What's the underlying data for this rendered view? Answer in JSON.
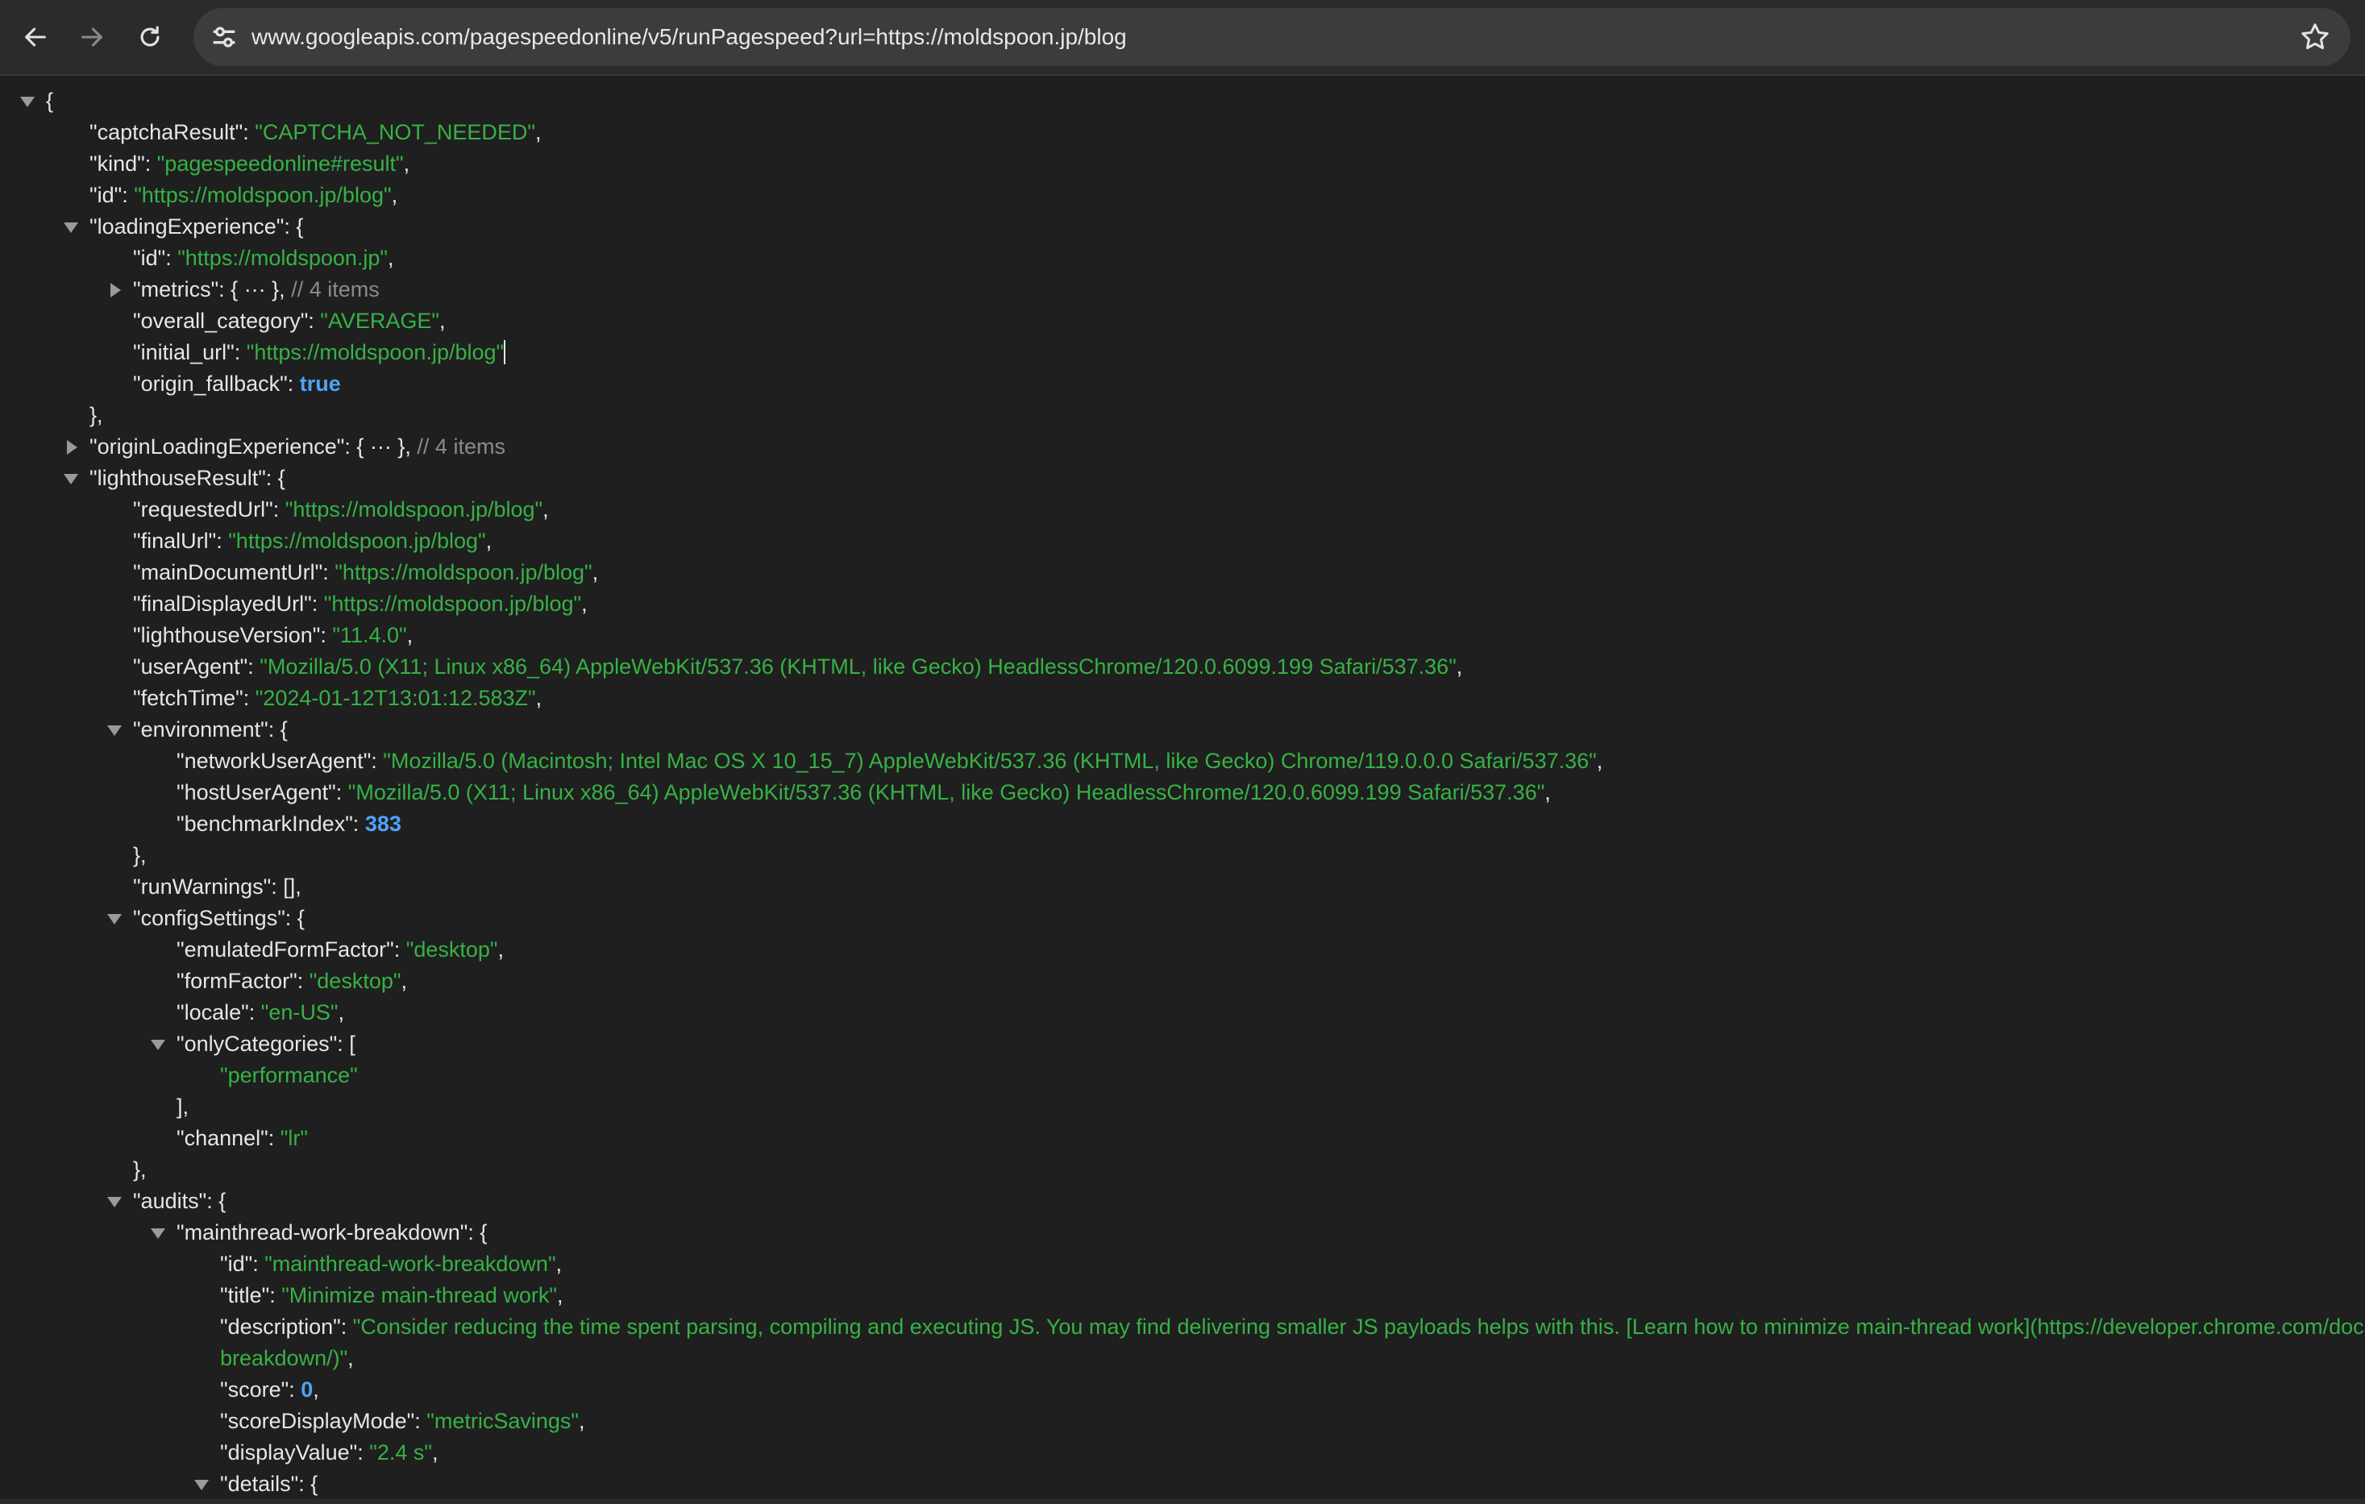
{
  "browser": {
    "url": "www.googleapis.com/pagespeedonline/v5/runPagespeed?url=https://moldspoon.jp/blog",
    "icons": {
      "back": "arrow-left-icon",
      "forward": "arrow-right-icon",
      "reload": "reload-icon",
      "site_info": "tune-icon",
      "bookmark": "star-icon"
    }
  },
  "colors": {
    "background": "#1f1f1f",
    "key": "#e6e6e6",
    "string": "#36b245",
    "number": "#4fa3f7",
    "comment": "#8b8b8b"
  },
  "json": {
    "lines": [
      {
        "indent": 0,
        "caret": "open",
        "parts": [
          {
            "t": "p",
            "v": "{"
          }
        ]
      },
      {
        "indent": 1,
        "parts": [
          {
            "t": "k",
            "v": "\"captchaResult\""
          },
          {
            "t": "p",
            "v": ": "
          },
          {
            "t": "s",
            "v": "\"CAPTCHA_NOT_NEEDED\""
          },
          {
            "t": "p",
            "v": ","
          }
        ]
      },
      {
        "indent": 1,
        "parts": [
          {
            "t": "k",
            "v": "\"kind\""
          },
          {
            "t": "p",
            "v": ": "
          },
          {
            "t": "s",
            "v": "\"pagespeedonline#result\""
          },
          {
            "t": "p",
            "v": ","
          }
        ]
      },
      {
        "indent": 1,
        "parts": [
          {
            "t": "k",
            "v": "\"id\""
          },
          {
            "t": "p",
            "v": ": "
          },
          {
            "t": "s",
            "v": "\"https://moldspoon.jp/blog\""
          },
          {
            "t": "p",
            "v": ","
          }
        ]
      },
      {
        "indent": 1,
        "caret": "open",
        "parts": [
          {
            "t": "k",
            "v": "\"loadingExperience\""
          },
          {
            "t": "p",
            "v": ": {"
          }
        ]
      },
      {
        "indent": 2,
        "parts": [
          {
            "t": "k",
            "v": "\"id\""
          },
          {
            "t": "p",
            "v": ": "
          },
          {
            "t": "s",
            "v": "\"https://moldspoon.jp\""
          },
          {
            "t": "p",
            "v": ","
          }
        ]
      },
      {
        "indent": 2,
        "caret": "closed",
        "parts": [
          {
            "t": "k",
            "v": "\"metrics\""
          },
          {
            "t": "p",
            "v": ": { ··· }, "
          },
          {
            "t": "c",
            "v": "// 4 items"
          }
        ]
      },
      {
        "indent": 2,
        "parts": [
          {
            "t": "k",
            "v": "\"overall_category\""
          },
          {
            "t": "p",
            "v": ": "
          },
          {
            "t": "s",
            "v": "\"AVERAGE\""
          },
          {
            "t": "p",
            "v": ","
          }
        ]
      },
      {
        "indent": 2,
        "cursor": true,
        "parts": [
          {
            "t": "k",
            "v": "\"initial_url\""
          },
          {
            "t": "p",
            "v": ": "
          },
          {
            "t": "s",
            "v": "\"https://moldspoon.jp/blog\""
          }
        ]
      },
      {
        "indent": 2,
        "parts": [
          {
            "t": "k",
            "v": "\"origin_fallback\""
          },
          {
            "t": "p",
            "v": ": "
          },
          {
            "t": "b",
            "v": "true"
          }
        ]
      },
      {
        "indent": 1,
        "parts": [
          {
            "t": "p",
            "v": "},"
          }
        ]
      },
      {
        "indent": 1,
        "caret": "closed",
        "parts": [
          {
            "t": "k",
            "v": "\"originLoadingExperience\""
          },
          {
            "t": "p",
            "v": ": { ··· }, "
          },
          {
            "t": "c",
            "v": "// 4 items"
          }
        ]
      },
      {
        "indent": 1,
        "caret": "open",
        "parts": [
          {
            "t": "k",
            "v": "\"lighthouseResult\""
          },
          {
            "t": "p",
            "v": ": {"
          }
        ]
      },
      {
        "indent": 2,
        "parts": [
          {
            "t": "k",
            "v": "\"requestedUrl\""
          },
          {
            "t": "p",
            "v": ": "
          },
          {
            "t": "s",
            "v": "\"https://moldspoon.jp/blog\""
          },
          {
            "t": "p",
            "v": ","
          }
        ]
      },
      {
        "indent": 2,
        "parts": [
          {
            "t": "k",
            "v": "\"finalUrl\""
          },
          {
            "t": "p",
            "v": ": "
          },
          {
            "t": "s",
            "v": "\"https://moldspoon.jp/blog\""
          },
          {
            "t": "p",
            "v": ","
          }
        ]
      },
      {
        "indent": 2,
        "parts": [
          {
            "t": "k",
            "v": "\"mainDocumentUrl\""
          },
          {
            "t": "p",
            "v": ": "
          },
          {
            "t": "s",
            "v": "\"https://moldspoon.jp/blog\""
          },
          {
            "t": "p",
            "v": ","
          }
        ]
      },
      {
        "indent": 2,
        "parts": [
          {
            "t": "k",
            "v": "\"finalDisplayedUrl\""
          },
          {
            "t": "p",
            "v": ": "
          },
          {
            "t": "s",
            "v": "\"https://moldspoon.jp/blog\""
          },
          {
            "t": "p",
            "v": ","
          }
        ]
      },
      {
        "indent": 2,
        "parts": [
          {
            "t": "k",
            "v": "\"lighthouseVersion\""
          },
          {
            "t": "p",
            "v": ": "
          },
          {
            "t": "s",
            "v": "\"11.4.0\""
          },
          {
            "t": "p",
            "v": ","
          }
        ]
      },
      {
        "indent": 2,
        "parts": [
          {
            "t": "k",
            "v": "\"userAgent\""
          },
          {
            "t": "p",
            "v": ": "
          },
          {
            "t": "s",
            "v": "\"Mozilla/5.0 (X11; Linux x86_64) AppleWebKit/537.36 (KHTML, like Gecko) HeadlessChrome/120.0.6099.199 Safari/537.36\""
          },
          {
            "t": "p",
            "v": ","
          }
        ]
      },
      {
        "indent": 2,
        "parts": [
          {
            "t": "k",
            "v": "\"fetchTime\""
          },
          {
            "t": "p",
            "v": ": "
          },
          {
            "t": "s",
            "v": "\"2024-01-12T13:01:12.583Z\""
          },
          {
            "t": "p",
            "v": ","
          }
        ]
      },
      {
        "indent": 2,
        "caret": "open",
        "parts": [
          {
            "t": "k",
            "v": "\"environment\""
          },
          {
            "t": "p",
            "v": ": {"
          }
        ]
      },
      {
        "indent": 3,
        "parts": [
          {
            "t": "k",
            "v": "\"networkUserAgent\""
          },
          {
            "t": "p",
            "v": ": "
          },
          {
            "t": "s",
            "v": "\"Mozilla/5.0 (Macintosh; Intel Mac OS X 10_15_7) AppleWebKit/537.36 (KHTML, like Gecko) Chrome/119.0.0.0 Safari/537.36\""
          },
          {
            "t": "p",
            "v": ","
          }
        ]
      },
      {
        "indent": 3,
        "parts": [
          {
            "t": "k",
            "v": "\"hostUserAgent\""
          },
          {
            "t": "p",
            "v": ": "
          },
          {
            "t": "s",
            "v": "\"Mozilla/5.0 (X11; Linux x86_64) AppleWebKit/537.36 (KHTML, like Gecko) HeadlessChrome/120.0.6099.199 Safari/537.36\""
          },
          {
            "t": "p",
            "v": ","
          }
        ]
      },
      {
        "indent": 3,
        "parts": [
          {
            "t": "k",
            "v": "\"benchmarkIndex\""
          },
          {
            "t": "p",
            "v": ": "
          },
          {
            "t": "b",
            "v": "383"
          }
        ]
      },
      {
        "indent": 2,
        "parts": [
          {
            "t": "p",
            "v": "},"
          }
        ]
      },
      {
        "indent": 2,
        "parts": [
          {
            "t": "k",
            "v": "\"runWarnings\""
          },
          {
            "t": "p",
            "v": ": [],"
          }
        ]
      },
      {
        "indent": 2,
        "caret": "open",
        "parts": [
          {
            "t": "k",
            "v": "\"configSettings\""
          },
          {
            "t": "p",
            "v": ": {"
          }
        ]
      },
      {
        "indent": 3,
        "parts": [
          {
            "t": "k",
            "v": "\"emulatedFormFactor\""
          },
          {
            "t": "p",
            "v": ": "
          },
          {
            "t": "s",
            "v": "\"desktop\""
          },
          {
            "t": "p",
            "v": ","
          }
        ]
      },
      {
        "indent": 3,
        "parts": [
          {
            "t": "k",
            "v": "\"formFactor\""
          },
          {
            "t": "p",
            "v": ": "
          },
          {
            "t": "s",
            "v": "\"desktop\""
          },
          {
            "t": "p",
            "v": ","
          }
        ]
      },
      {
        "indent": 3,
        "parts": [
          {
            "t": "k",
            "v": "\"locale\""
          },
          {
            "t": "p",
            "v": ": "
          },
          {
            "t": "s",
            "v": "\"en-US\""
          },
          {
            "t": "p",
            "v": ","
          }
        ]
      },
      {
        "indent": 3,
        "caret": "open",
        "parts": [
          {
            "t": "k",
            "v": "\"onlyCategories\""
          },
          {
            "t": "p",
            "v": ": ["
          }
        ]
      },
      {
        "indent": 4,
        "parts": [
          {
            "t": "s",
            "v": "\"performance\""
          }
        ]
      },
      {
        "indent": 3,
        "parts": [
          {
            "t": "p",
            "v": "],"
          }
        ]
      },
      {
        "indent": 3,
        "parts": [
          {
            "t": "k",
            "v": "\"channel\""
          },
          {
            "t": "p",
            "v": ": "
          },
          {
            "t": "s",
            "v": "\"lr\""
          }
        ]
      },
      {
        "indent": 2,
        "parts": [
          {
            "t": "p",
            "v": "},"
          }
        ]
      },
      {
        "indent": 2,
        "caret": "open",
        "parts": [
          {
            "t": "k",
            "v": "\"audits\""
          },
          {
            "t": "p",
            "v": ": {"
          }
        ]
      },
      {
        "indent": 3,
        "caret": "open",
        "parts": [
          {
            "t": "k",
            "v": "\"mainthread-work-breakdown\""
          },
          {
            "t": "p",
            "v": ": {"
          }
        ]
      },
      {
        "indent": 4,
        "parts": [
          {
            "t": "k",
            "v": "\"id\""
          },
          {
            "t": "p",
            "v": ": "
          },
          {
            "t": "s",
            "v": "\"mainthread-work-breakdown\""
          },
          {
            "t": "p",
            "v": ","
          }
        ]
      },
      {
        "indent": 4,
        "parts": [
          {
            "t": "k",
            "v": "\"title\""
          },
          {
            "t": "p",
            "v": ": "
          },
          {
            "t": "s",
            "v": "\"Minimize main-thread work\""
          },
          {
            "t": "p",
            "v": ","
          }
        ]
      },
      {
        "indent": 4,
        "parts": [
          {
            "t": "k",
            "v": "\"description\""
          },
          {
            "t": "p",
            "v": ": "
          },
          {
            "t": "s",
            "v": "\"Consider reducing the time spent parsing, compiling and executing JS. You may find delivering smaller JS payloads helps with this. [Learn how to minimize main-thread work](https://developer.chrome.com/docs/lighthouse/performance/mainthread-work-"
          }
        ]
      },
      {
        "indent": 4,
        "parts": [
          {
            "t": "s",
            "v": "breakdown/)\""
          },
          {
            "t": "p",
            "v": ","
          }
        ]
      },
      {
        "indent": 4,
        "parts": [
          {
            "t": "k",
            "v": "\"score\""
          },
          {
            "t": "p",
            "v": ": "
          },
          {
            "t": "b",
            "v": "0"
          },
          {
            "t": "p",
            "v": ","
          }
        ]
      },
      {
        "indent": 4,
        "parts": [
          {
            "t": "k",
            "v": "\"scoreDisplayMode\""
          },
          {
            "t": "p",
            "v": ": "
          },
          {
            "t": "s",
            "v": "\"metricSavings\""
          },
          {
            "t": "p",
            "v": ","
          }
        ]
      },
      {
        "indent": 4,
        "parts": [
          {
            "t": "k",
            "v": "\"displayValue\""
          },
          {
            "t": "p",
            "v": ": "
          },
          {
            "t": "s",
            "v": "\"2.4 s\""
          },
          {
            "t": "p",
            "v": ","
          }
        ]
      },
      {
        "indent": 4,
        "caret": "open",
        "parts": [
          {
            "t": "k",
            "v": "\"details\""
          },
          {
            "t": "p",
            "v": ": {"
          }
        ]
      }
    ]
  }
}
